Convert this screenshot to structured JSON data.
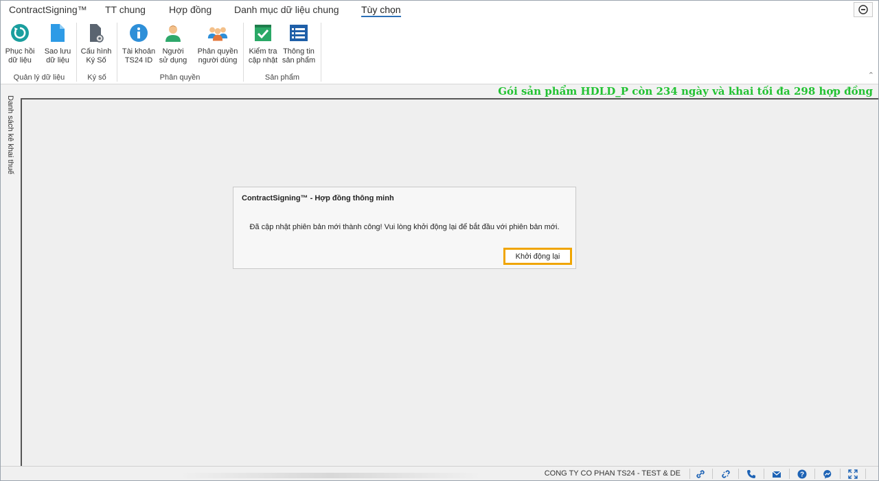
{
  "tabs": [
    {
      "label": "ContractSigning™"
    },
    {
      "label": "TT chung"
    },
    {
      "label": "Hợp đồng"
    },
    {
      "label": "Danh mục dữ liệu chung"
    },
    {
      "label": "Tùy chọn",
      "active": true
    }
  ],
  "ribbon": {
    "groups": [
      {
        "label": "Quản lý dữ liệu"
      },
      {
        "label": "Ký số"
      },
      {
        "label": "Phân quyền"
      },
      {
        "label": "Sản phẩm"
      }
    ],
    "buttons": [
      {
        "line1": "Phục hồi",
        "line2": "dữ liệu",
        "icon": "restore-icon"
      },
      {
        "line1": "Sao lưu",
        "line2": "dữ liệu",
        "icon": "backup-file-icon"
      },
      {
        "line1": "Cấu hình",
        "line2": "Ký Số",
        "icon": "sign-config-icon"
      },
      {
        "line1": "Tài khoản",
        "line2": "TS24 ID",
        "icon": "info-icon"
      },
      {
        "line1": "Người",
        "line2": "sử dụng",
        "icon": "user-icon"
      },
      {
        "line1": "Phân quyền",
        "line2": "người dùng",
        "icon": "user-group-icon"
      },
      {
        "line1": "Kiểm tra",
        "line2": "cập nhật",
        "icon": "check-update-icon"
      },
      {
        "line1": "Thông tin",
        "line2": "sản phẩm",
        "icon": "product-info-icon"
      }
    ]
  },
  "banner": {
    "text": "Gói sản phẩm HDLD_P còn 234 ngày và khai tối đa 298 hợp đồng",
    "color": "#22c232"
  },
  "side_panel": {
    "label": "Danh sách kê khai thuế"
  },
  "dialog": {
    "title": "ContractSigning™ - Hợp đồng thông minh",
    "message": "Đã cập nhật phiên bản mới thành công! Vui lòng khởi động lại để bắt đầu với phiên bản mới.",
    "button_label": "Khởi động lại",
    "button_border_color": "#f0a500"
  },
  "statusbar": {
    "company": "CONG TY CO PHAN TS24 - TEST & DE",
    "icons": [
      "link-icon",
      "unlink-icon",
      "phone-icon",
      "mail-icon",
      "help-icon",
      "messenger-icon",
      "fullscreen-icon"
    ]
  }
}
